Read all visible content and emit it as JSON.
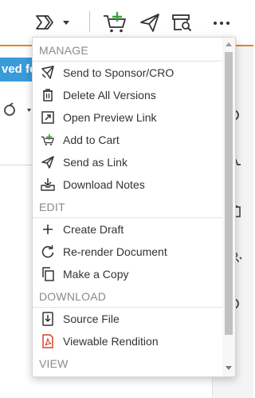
{
  "banner": {
    "text": "ved fo"
  },
  "menu": {
    "sections": [
      {
        "title": "MANAGE",
        "items": [
          {
            "label": "Send to Sponsor/CRO",
            "icon": "send-to-sponsor-icon"
          },
          {
            "label": "Delete All Versions",
            "icon": "trash-icon"
          },
          {
            "label": "Open Preview Link",
            "icon": "open-external-icon"
          },
          {
            "label": "Add to Cart",
            "icon": "cart-add-icon"
          },
          {
            "label": "Send as Link",
            "icon": "paper-plane-icon"
          },
          {
            "label": "Download Notes",
            "icon": "download-tray-icon"
          }
        ]
      },
      {
        "title": "EDIT",
        "items": [
          {
            "label": "Create Draft",
            "icon": "plus-icon"
          },
          {
            "label": "Re-render Document",
            "icon": "refresh-icon"
          },
          {
            "label": "Make a Copy",
            "icon": "copy-icon"
          }
        ]
      },
      {
        "title": "DOWNLOAD",
        "items": [
          {
            "label": "Source File",
            "icon": "download-file-icon"
          },
          {
            "label": "Viewable Rendition",
            "icon": "pdf-icon"
          }
        ]
      },
      {
        "title": "VIEW",
        "items": []
      }
    ]
  },
  "colors": {
    "accent": "#e8822a",
    "banner": "#3a9bd9",
    "green": "#3aa63a",
    "pdf_red": "#d9402b"
  }
}
